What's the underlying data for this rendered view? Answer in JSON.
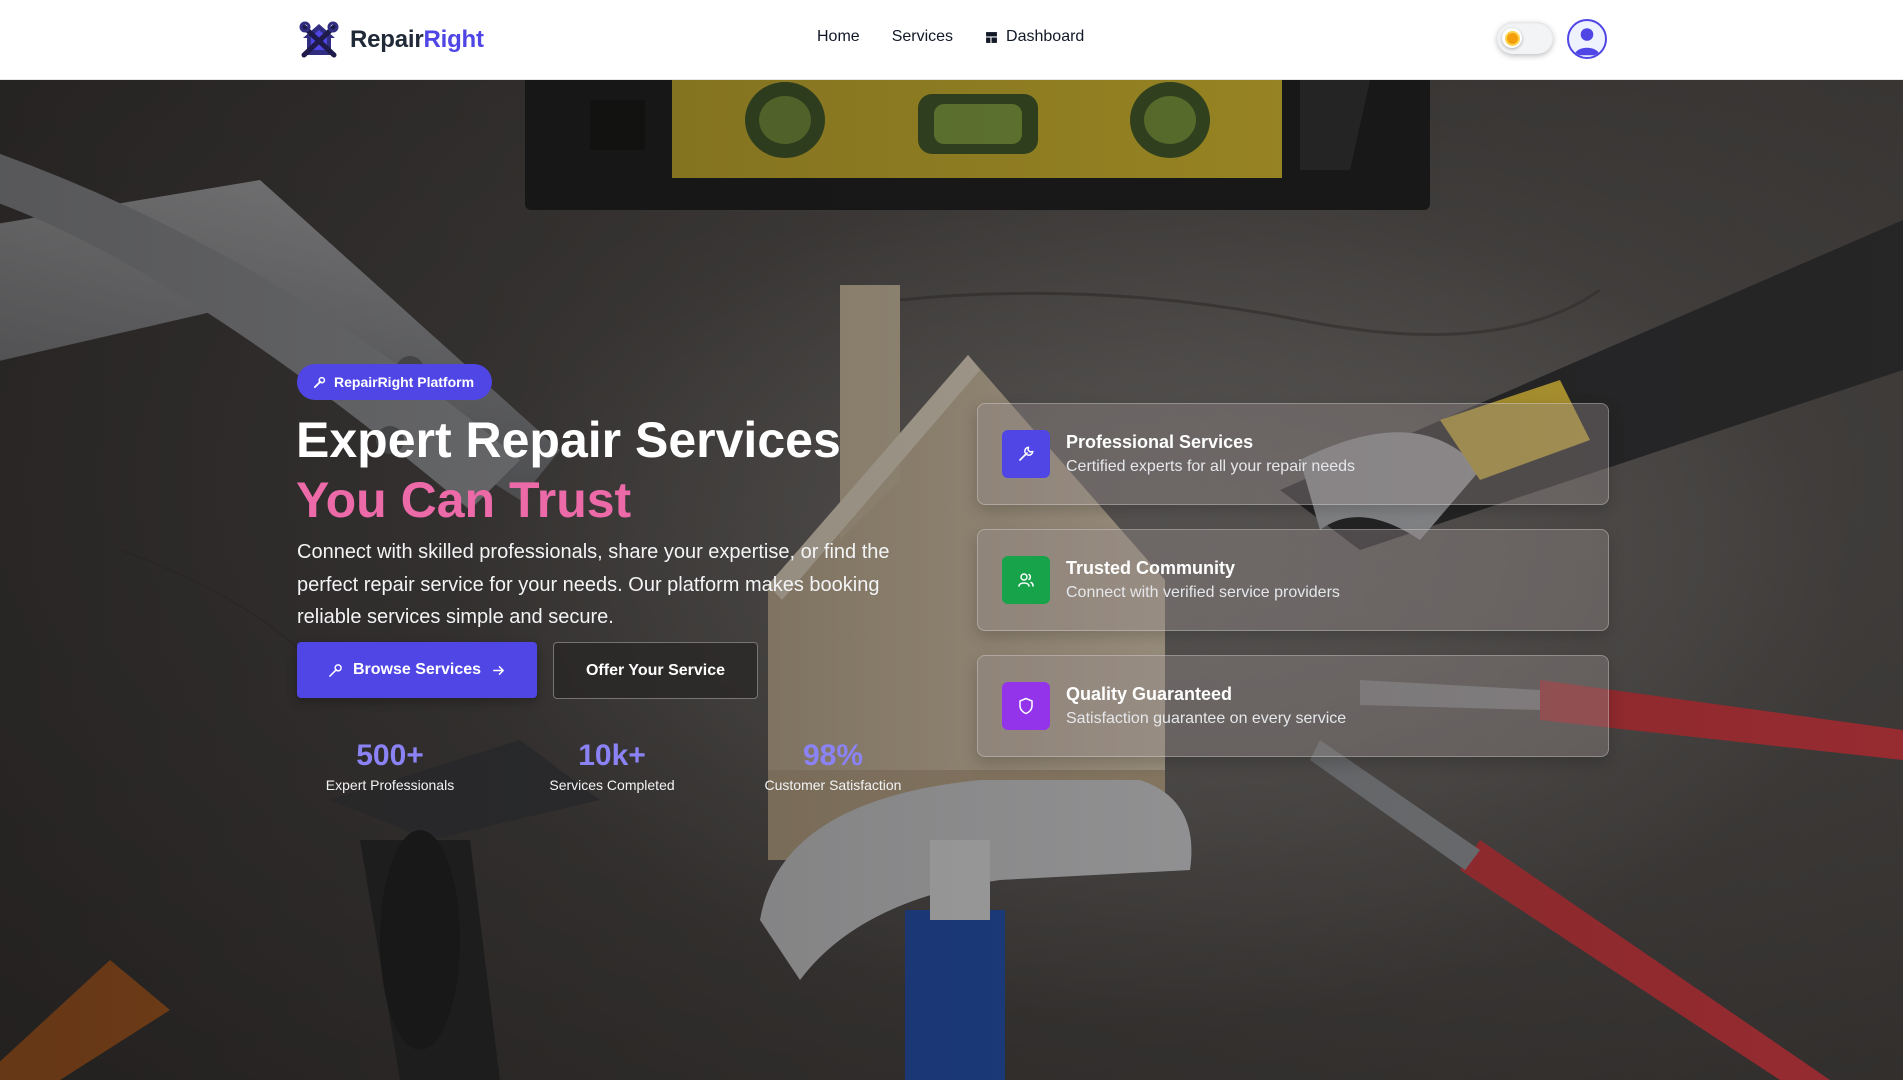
{
  "brand": {
    "name_part1": "Repair",
    "name_part2": "Right"
  },
  "nav": {
    "home": "Home",
    "services": "Services",
    "dashboard": "Dashboard"
  },
  "hero": {
    "badge": "RepairRight Platform",
    "title_line1": "Expert Repair Services",
    "title_line2": "You Can Trust",
    "description": "Connect with skilled professionals, share your expertise, or find the perfect repair service for your needs. Our platform makes booking reliable services simple and secure.",
    "primary_button": "Browse Services",
    "secondary_button": "Offer Your Service"
  },
  "stats": [
    {
      "value": "500+",
      "label": "Expert Professionals"
    },
    {
      "value": "10k+",
      "label": "Services Completed"
    },
    {
      "value": "98%",
      "label": "Customer Satisfaction"
    }
  ],
  "features": [
    {
      "title": "Professional Services",
      "description": "Certified experts for all your repair needs",
      "icon": "wrench-icon",
      "color": "#4f46e5"
    },
    {
      "title": "Trusted Community",
      "description": "Connect with verified service providers",
      "icon": "users-icon",
      "color": "#16a34a"
    },
    {
      "title": "Quality Guaranteed",
      "description": "Satisfaction guarantee on every service",
      "icon": "shield-icon",
      "color": "#9333ea"
    }
  ],
  "colors": {
    "primary": "#4f46e5",
    "accent_pink": "#ec6aa8",
    "stat_value": "#8b83f5"
  }
}
